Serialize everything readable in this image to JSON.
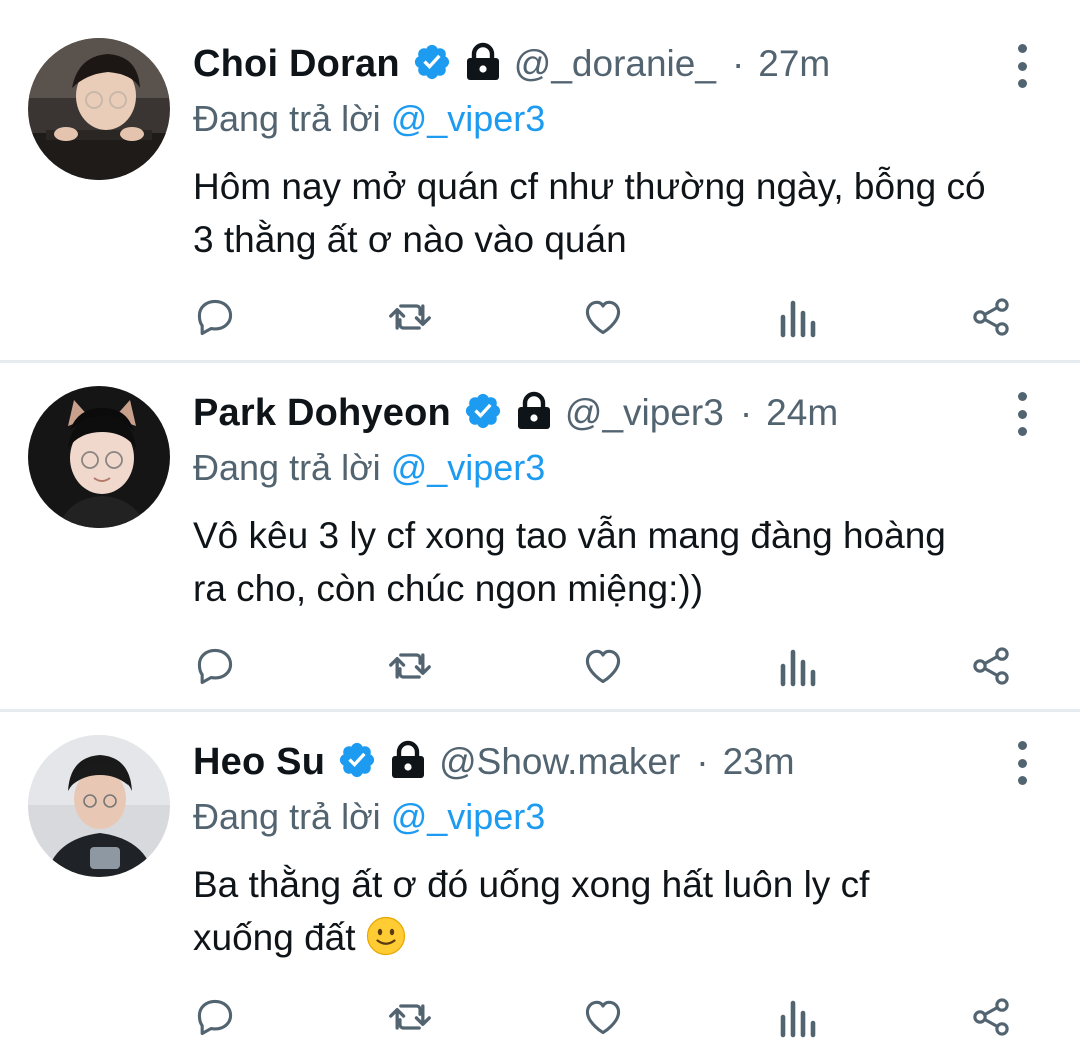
{
  "colors": {
    "accent": "#1d9bf0",
    "muted": "#536471",
    "text": "#0f1419",
    "divider": "#e6ecf0"
  },
  "icons": {
    "verified": "verified-badge-icon",
    "lock": "lock-icon",
    "more": "more-vertical-icon",
    "reply": "reply-icon",
    "retweet": "retweet-icon",
    "like": "heart-icon",
    "views": "views-icon",
    "share": "share-icon"
  },
  "tweets": [
    {
      "name": "Choi Doran",
      "handle": "@_doranie_",
      "separator": "·",
      "time": "27m",
      "reply_prefix": "Đang trả lời",
      "reply_to": "@_viper3",
      "text_lines": [
        "Hôm nay mở quán cf như thường ngày, bỗng có",
        "3 thằng ất ơ nào vào quán"
      ]
    },
    {
      "name": "Park Dohyeon",
      "handle": "@_viper3",
      "separator": "·",
      "time": "24m",
      "reply_prefix": "Đang trả lời",
      "reply_to": "@_viper3",
      "text_lines": [
        "Vô kêu 3 ly cf xong tao vẫn mang đàng hoàng",
        "ra cho, còn chúc ngon miệng:))"
      ]
    },
    {
      "name": "Heo Su",
      "handle": "@Show.maker",
      "separator": "·",
      "time": "23m",
      "reply_prefix": "Đang trả lời",
      "reply_to": "@_viper3",
      "text_lines": [
        "Ba thằng ất ơ đó uống xong hất luôn ly cf",
        "xuống đất"
      ],
      "trailing_emoji": "slightly-smiling-face-emoji"
    }
  ]
}
